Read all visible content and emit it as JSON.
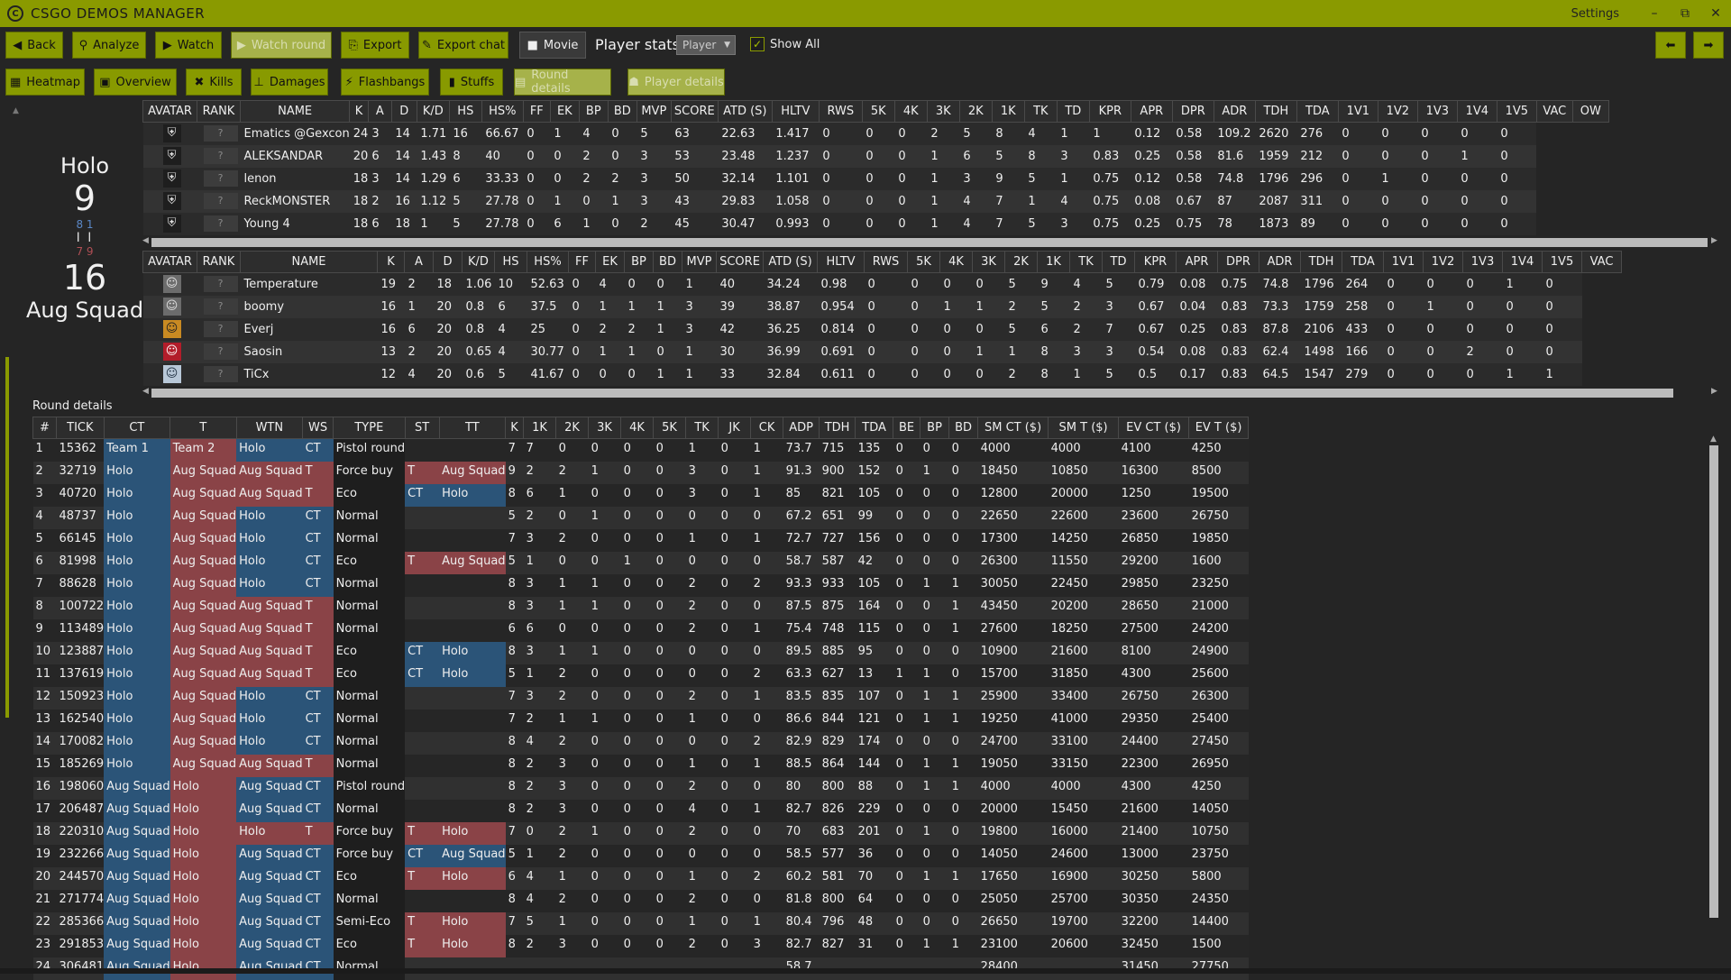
{
  "app": {
    "title": "CSGO DEMOS MANAGER",
    "settings": "Settings",
    "window_buttons": [
      "–",
      "⧉",
      "✕"
    ]
  },
  "toolbar1": {
    "back": "Back",
    "analyze": "Analyze",
    "watch": "Watch",
    "watch_round": "Watch round",
    "export": "Export",
    "export_chat": "Export chat",
    "movie": "Movie",
    "player_stats": "Player stats",
    "player_select": "Player",
    "show_all": "Show All"
  },
  "toolbar2": {
    "heatmap": "Heatmap",
    "overview": "Overview",
    "kills": "Kills",
    "damages": "Damages",
    "flashbangs": "Flashbangs",
    "stuffs": "Stuffs",
    "round_details": "Round details",
    "player_details": "Player details"
  },
  "scoreboard": {
    "team1": "Holo",
    "score1": "9",
    "half1": "8 1",
    "bars": "I I",
    "half2": "7 9",
    "score2": "16",
    "team2": "Aug Squad"
  },
  "player_columns": [
    "AVATAR",
    "RANK",
    "NAME",
    "K",
    "A",
    "D",
    "K/D",
    "HS",
    "HS%",
    "FF",
    "EK",
    "BP",
    "BD",
    "MVP",
    "SCORE",
    "ATD (S)",
    "HLTV",
    "RWS",
    "5K",
    "4K",
    "3K",
    "2K",
    "1K",
    "TK",
    "TD",
    "KPR",
    "APR",
    "DPR",
    "ADR",
    "TDH",
    "TDA",
    "1V1",
    "1V2",
    "1V3",
    "1V4",
    "1V5",
    "VAC",
    "OW"
  ],
  "team1_players": [
    [
      "Ematics @Gexcon",
      "24",
      "3",
      "14",
      "1.71",
      "16",
      "66.67",
      "0",
      "1",
      "4",
      "0",
      "5",
      "63",
      "22.63",
      "1.417",
      "0",
      "0",
      "0",
      "2",
      "5",
      "8",
      "4",
      "1",
      "1",
      "0.12",
      "0.58",
      "109.2",
      "2620",
      "276",
      "0",
      "0",
      "0",
      "0",
      "0"
    ],
    [
      "ALEKSANDAR",
      "20",
      "6",
      "14",
      "1.43",
      "8",
      "40",
      "0",
      "0",
      "2",
      "0",
      "3",
      "53",
      "23.48",
      "1.237",
      "0",
      "0",
      "0",
      "1",
      "6",
      "5",
      "8",
      "3",
      "0.83",
      "0.25",
      "0.58",
      "81.6",
      "1959",
      "212",
      "0",
      "0",
      "0",
      "1",
      "0"
    ],
    [
      "lenon",
      "18",
      "3",
      "14",
      "1.29",
      "6",
      "33.33",
      "0",
      "0",
      "2",
      "2",
      "3",
      "50",
      "32.14",
      "1.101",
      "0",
      "0",
      "0",
      "1",
      "3",
      "9",
      "5",
      "1",
      "0.75",
      "0.12",
      "0.58",
      "74.8",
      "1796",
      "296",
      "0",
      "1",
      "0",
      "0",
      "0"
    ],
    [
      "ReckMONSTER",
      "18",
      "2",
      "16",
      "1.12",
      "5",
      "27.78",
      "0",
      "1",
      "0",
      "1",
      "3",
      "43",
      "29.83",
      "1.058",
      "0",
      "0",
      "0",
      "1",
      "4",
      "7",
      "1",
      "4",
      "0.75",
      "0.08",
      "0.67",
      "87",
      "2087",
      "311",
      "0",
      "0",
      "0",
      "0",
      "0"
    ],
    [
      "Young 4",
      "18",
      "6",
      "18",
      "1",
      "5",
      "27.78",
      "0",
      "6",
      "1",
      "0",
      "2",
      "45",
      "30.47",
      "0.993",
      "0",
      "0",
      "0",
      "1",
      "4",
      "7",
      "5",
      "3",
      "0.75",
      "0.25",
      "0.75",
      "78",
      "1873",
      "89",
      "0",
      "0",
      "0",
      "0",
      "0"
    ]
  ],
  "player_columns2": [
    "AVATAR",
    "RANK",
    "NAME",
    "K",
    "A",
    "D",
    "K/D",
    "HS",
    "HS%",
    "FF",
    "EK",
    "BP",
    "BD",
    "MVP",
    "SCORE",
    "ATD (S)",
    "HLTV",
    "RWS",
    "5K",
    "4K",
    "3K",
    "2K",
    "1K",
    "TK",
    "TD",
    "KPR",
    "APR",
    "DPR",
    "ADR",
    "TDH",
    "TDA",
    "1V1",
    "1V2",
    "1V3",
    "1V4",
    "1V5",
    "VAC"
  ],
  "team2_players": [
    [
      "Temperature",
      "19",
      "2",
      "18",
      "1.06",
      "10",
      "52.63",
      "0",
      "4",
      "0",
      "0",
      "1",
      "40",
      "34.24",
      "0.98",
      "0",
      "0",
      "0",
      "0",
      "5",
      "9",
      "4",
      "5",
      "0.79",
      "0.08",
      "0.75",
      "74.8",
      "1796",
      "264",
      "0",
      "0",
      "0",
      "1",
      "0"
    ],
    [
      "boomy",
      "16",
      "1",
      "20",
      "0.8",
      "6",
      "37.5",
      "0",
      "1",
      "1",
      "1",
      "3",
      "39",
      "38.87",
      "0.954",
      "0",
      "0",
      "1",
      "1",
      "2",
      "5",
      "2",
      "3",
      "0.67",
      "0.04",
      "0.83",
      "73.3",
      "1759",
      "258",
      "0",
      "1",
      "0",
      "0",
      "0"
    ],
    [
      "Everj",
      "16",
      "6",
      "20",
      "0.8",
      "4",
      "25",
      "0",
      "2",
      "2",
      "1",
      "3",
      "42",
      "36.25",
      "0.814",
      "0",
      "0",
      "0",
      "0",
      "5",
      "6",
      "2",
      "7",
      "0.67",
      "0.25",
      "0.83",
      "87.8",
      "2106",
      "433",
      "0",
      "0",
      "0",
      "0",
      "0"
    ],
    [
      "Saosin",
      "13",
      "2",
      "20",
      "0.65",
      "4",
      "30.77",
      "0",
      "1",
      "1",
      "0",
      "1",
      "30",
      "36.99",
      "0.691",
      "0",
      "0",
      "0",
      "1",
      "1",
      "8",
      "3",
      "3",
      "0.54",
      "0.08",
      "0.83",
      "62.4",
      "1498",
      "166",
      "0",
      "0",
      "2",
      "0",
      "0"
    ],
    [
      "TiCx",
      "12",
      "4",
      "20",
      "0.6",
      "5",
      "41.67",
      "0",
      "0",
      "0",
      "1",
      "1",
      "33",
      "32.84",
      "0.611",
      "0",
      "0",
      "0",
      "0",
      "2",
      "8",
      "1",
      "5",
      "0.5",
      "0.17",
      "0.83",
      "64.5",
      "1547",
      "279",
      "0",
      "0",
      "0",
      "1",
      "1"
    ]
  ],
  "round_label": "Round details",
  "round_columns": [
    "#",
    "TICK",
    "CT",
    "T",
    "WTN",
    "WS",
    "TYPE",
    "ST",
    "TT",
    "K",
    "1K",
    "2K",
    "3K",
    "4K",
    "5K",
    "TK",
    "JK",
    "CK",
    "ADP",
    "TDH",
    "TDA",
    "BE",
    "BP",
    "BD",
    "SM CT ($)",
    "SM T ($)",
    "EV CT ($)",
    "EV T ($)"
  ],
  "rounds": [
    [
      "1",
      "15362",
      "Team 1",
      "Team 2",
      "Holo",
      "CT",
      "Pistol round",
      "",
      "",
      "7",
      "7",
      "0",
      "0",
      "0",
      "0",
      "1",
      "0",
      "1",
      "73.7",
      "715",
      "135",
      "0",
      "0",
      "0",
      "4000",
      "4000",
      "4100",
      "4250"
    ],
    [
      "2",
      "32719",
      "Holo",
      "Aug Squad",
      "Aug Squad",
      "T",
      "Force buy",
      "T",
      "Aug Squad",
      "9",
      "2",
      "2",
      "1",
      "0",
      "0",
      "3",
      "0",
      "1",
      "91.3",
      "900",
      "152",
      "0",
      "1",
      "0",
      "18450",
      "10850",
      "16300",
      "8500"
    ],
    [
      "3",
      "40720",
      "Holo",
      "Aug Squad",
      "Aug Squad",
      "T",
      "Eco",
      "CT",
      "Holo",
      "8",
      "6",
      "1",
      "0",
      "0",
      "0",
      "3",
      "0",
      "1",
      "85",
      "821",
      "105",
      "0",
      "0",
      "0",
      "12800",
      "20000",
      "1250",
      "19500"
    ],
    [
      "4",
      "48737",
      "Holo",
      "Aug Squad",
      "Holo",
      "CT",
      "Normal",
      "",
      "",
      "5",
      "2",
      "0",
      "1",
      "0",
      "0",
      "0",
      "0",
      "0",
      "67.2",
      "651",
      "99",
      "0",
      "0",
      "0",
      "22650",
      "22600",
      "23600",
      "26750"
    ],
    [
      "5",
      "66145",
      "Holo",
      "Aug Squad",
      "Holo",
      "CT",
      "Normal",
      "",
      "",
      "7",
      "3",
      "2",
      "0",
      "0",
      "0",
      "1",
      "0",
      "1",
      "72.7",
      "727",
      "156",
      "0",
      "0",
      "0",
      "17300",
      "14250",
      "26850",
      "19850"
    ],
    [
      "6",
      "81998",
      "Holo",
      "Aug Squad",
      "Holo",
      "CT",
      "Eco",
      "T",
      "Aug Squad",
      "5",
      "1",
      "0",
      "0",
      "1",
      "0",
      "0",
      "0",
      "0",
      "58.7",
      "587",
      "42",
      "0",
      "0",
      "0",
      "26300",
      "11550",
      "29200",
      "1600"
    ],
    [
      "7",
      "88628",
      "Holo",
      "Aug Squad",
      "Holo",
      "CT",
      "Normal",
      "",
      "",
      "8",
      "3",
      "1",
      "1",
      "0",
      "0",
      "2",
      "0",
      "2",
      "93.3",
      "933",
      "105",
      "0",
      "1",
      "1",
      "30050",
      "22450",
      "29850",
      "23250"
    ],
    [
      "8",
      "100722",
      "Holo",
      "Aug Squad",
      "Aug Squad",
      "T",
      "Normal",
      "",
      "",
      "8",
      "3",
      "1",
      "1",
      "0",
      "0",
      "2",
      "0",
      "0",
      "87.5",
      "875",
      "164",
      "0",
      "0",
      "1",
      "43450",
      "20200",
      "28650",
      "21000"
    ],
    [
      "9",
      "113489",
      "Holo",
      "Aug Squad",
      "Aug Squad",
      "T",
      "Normal",
      "",
      "",
      "6",
      "6",
      "0",
      "0",
      "0",
      "0",
      "2",
      "0",
      "1",
      "75.4",
      "748",
      "115",
      "0",
      "0",
      "1",
      "27600",
      "18250",
      "27500",
      "24200"
    ],
    [
      "10",
      "123887",
      "Holo",
      "Aug Squad",
      "Aug Squad",
      "T",
      "Eco",
      "CT",
      "Holo",
      "8",
      "3",
      "1",
      "1",
      "0",
      "0",
      "0",
      "0",
      "0",
      "89.5",
      "885",
      "95",
      "0",
      "0",
      "0",
      "10900",
      "21600",
      "8100",
      "24900"
    ],
    [
      "11",
      "137619",
      "Holo",
      "Aug Squad",
      "Aug Squad",
      "T",
      "Eco",
      "CT",
      "Holo",
      "5",
      "1",
      "2",
      "0",
      "0",
      "0",
      "0",
      "0",
      "2",
      "63.3",
      "627",
      "13",
      "1",
      "1",
      "0",
      "15700",
      "31850",
      "4300",
      "25600"
    ],
    [
      "12",
      "150923",
      "Holo",
      "Aug Squad",
      "Holo",
      "CT",
      "Normal",
      "",
      "",
      "7",
      "3",
      "2",
      "0",
      "0",
      "0",
      "2",
      "0",
      "1",
      "83.5",
      "835",
      "107",
      "0",
      "1",
      "1",
      "25900",
      "33400",
      "26750",
      "26300"
    ],
    [
      "13",
      "162540",
      "Holo",
      "Aug Squad",
      "Holo",
      "CT",
      "Normal",
      "",
      "",
      "7",
      "2",
      "1",
      "1",
      "0",
      "0",
      "1",
      "0",
      "0",
      "86.6",
      "844",
      "121",
      "0",
      "1",
      "1",
      "19250",
      "41000",
      "29350",
      "25400"
    ],
    [
      "14",
      "170082",
      "Holo",
      "Aug Squad",
      "Holo",
      "CT",
      "Normal",
      "",
      "",
      "8",
      "4",
      "2",
      "0",
      "0",
      "0",
      "0",
      "0",
      "2",
      "82.9",
      "829",
      "174",
      "0",
      "0",
      "0",
      "24700",
      "33100",
      "24400",
      "27450"
    ],
    [
      "15",
      "185269",
      "Holo",
      "Aug Squad",
      "Aug Squad",
      "T",
      "Normal",
      "",
      "",
      "8",
      "2",
      "3",
      "0",
      "0",
      "0",
      "1",
      "0",
      "1",
      "88.5",
      "864",
      "144",
      "0",
      "1",
      "1",
      "19050",
      "33150",
      "22300",
      "26950"
    ],
    [
      "16",
      "198060",
      "Aug Squad",
      "Holo",
      "Aug Squad",
      "CT",
      "Pistol round",
      "",
      "",
      "8",
      "2",
      "3",
      "0",
      "0",
      "0",
      "2",
      "0",
      "0",
      "80",
      "800",
      "88",
      "0",
      "1",
      "1",
      "4000",
      "4000",
      "4300",
      "4250"
    ],
    [
      "17",
      "206487",
      "Aug Squad",
      "Holo",
      "Aug Squad",
      "CT",
      "Normal",
      "",
      "",
      "8",
      "2",
      "3",
      "0",
      "0",
      "0",
      "4",
      "0",
      "1",
      "82.7",
      "826",
      "229",
      "0",
      "0",
      "0",
      "20000",
      "15450",
      "21600",
      "14050"
    ],
    [
      "18",
      "220310",
      "Aug Squad",
      "Holo",
      "Holo",
      "T",
      "Force buy",
      "T",
      "Holo",
      "7",
      "0",
      "2",
      "1",
      "0",
      "0",
      "2",
      "0",
      "0",
      "70",
      "683",
      "201",
      "0",
      "1",
      "0",
      "19800",
      "16000",
      "21400",
      "10750"
    ],
    [
      "19",
      "232266",
      "Aug Squad",
      "Holo",
      "Aug Squad",
      "CT",
      "Force buy",
      "CT",
      "Aug Squad",
      "5",
      "1",
      "2",
      "0",
      "0",
      "0",
      "0",
      "0",
      "0",
      "58.5",
      "577",
      "36",
      "0",
      "0",
      "0",
      "14050",
      "24600",
      "13000",
      "23750"
    ],
    [
      "20",
      "244570",
      "Aug Squad",
      "Holo",
      "Aug Squad",
      "CT",
      "Eco",
      "T",
      "Holo",
      "6",
      "4",
      "1",
      "0",
      "0",
      "0",
      "1",
      "0",
      "2",
      "60.2",
      "581",
      "70",
      "0",
      "1",
      "1",
      "17650",
      "16900",
      "30250",
      "5800"
    ],
    [
      "21",
      "271774",
      "Aug Squad",
      "Holo",
      "Aug Squad",
      "CT",
      "Normal",
      "",
      "",
      "8",
      "4",
      "2",
      "0",
      "0",
      "0",
      "2",
      "0",
      "0",
      "81.8",
      "800",
      "64",
      "0",
      "0",
      "0",
      "25050",
      "25700",
      "30350",
      "24350"
    ],
    [
      "22",
      "285366",
      "Aug Squad",
      "Holo",
      "Aug Squad",
      "CT",
      "Semi-Eco",
      "T",
      "Holo",
      "7",
      "5",
      "1",
      "0",
      "0",
      "0",
      "1",
      "0",
      "1",
      "80.4",
      "796",
      "48",
      "0",
      "0",
      "0",
      "26650",
      "19700",
      "32200",
      "14400"
    ],
    [
      "23",
      "291853",
      "Aug Squad",
      "Holo",
      "Aug Squad",
      "CT",
      "Eco",
      "T",
      "Holo",
      "8",
      "2",
      "3",
      "0",
      "0",
      "0",
      "2",
      "0",
      "3",
      "82.7",
      "827",
      "31",
      "0",
      "1",
      "1",
      "23100",
      "20600",
      "32450",
      "1500"
    ],
    [
      "24",
      "306481",
      "Aug Squad",
      "Holo",
      "Aug Squad",
      "CT",
      "Normal",
      "",
      "",
      "",
      "",
      "",
      "",
      "",
      "",
      "",
      "",
      "",
      "58.7",
      "",
      "",
      "",
      "",
      "",
      "28400",
      "",
      "31450",
      "27750"
    ]
  ],
  "colors": {
    "accent": "#8a9a00",
    "ct": "#2b5478",
    "t": "#8a4347"
  }
}
